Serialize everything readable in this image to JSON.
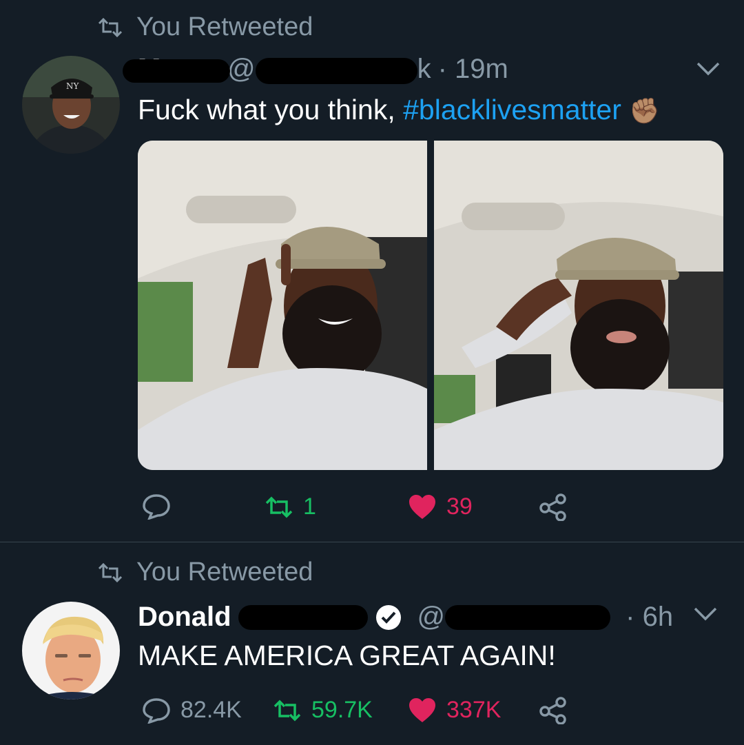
{
  "tweets": [
    {
      "retweet_label": "You Retweeted",
      "author_name": "M",
      "handle": "@",
      "handle_tail": "k",
      "time": "· 19m",
      "text": "Fuck what you think, ",
      "hashtag": "#blacklivesmatter",
      "emoji": "✊🏽",
      "stats": {
        "reply": "",
        "retweet": "1",
        "like": "39"
      }
    },
    {
      "retweet_label": "You Retweeted",
      "author_name": "Donald",
      "handle": "@",
      "time": "· 6h",
      "text": "MAKE AMERICA GREAT AGAIN!",
      "stats": {
        "reply": "82.4K",
        "retweet": "59.7K",
        "like": "337K"
      }
    }
  ],
  "colors": {
    "background": "#141d26",
    "muted": "#8899a6",
    "link": "#1da1f2",
    "retweet_green": "#17bf63",
    "like_pink": "#e0245e",
    "divider": "#38444d"
  },
  "icons": [
    "retweet-icon",
    "chevron-down-icon",
    "reply-icon",
    "like-icon",
    "share-icon",
    "verified-badge-icon"
  ]
}
